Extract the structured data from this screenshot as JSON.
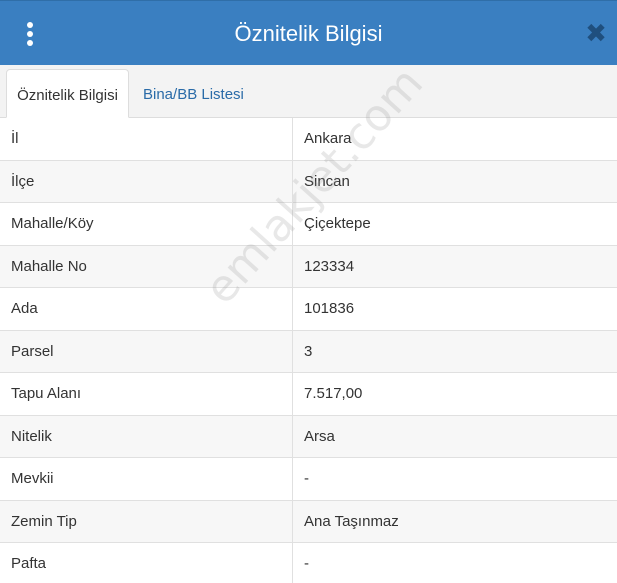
{
  "window": {
    "title": "Öznitelik Bilgisi",
    "menu_icon": "vertical-ellipsis-icon",
    "close_glyph": "✖"
  },
  "tabs": [
    {
      "label": "Öznitelik Bilgisi",
      "active": true
    },
    {
      "label": "Bina/BB Listesi",
      "active": false
    }
  ],
  "rows": [
    {
      "key": "İl",
      "value": "Ankara"
    },
    {
      "key": "İlçe",
      "value": "Sincan"
    },
    {
      "key": "Mahalle/Köy",
      "value": "Çiçektepe"
    },
    {
      "key": "Mahalle No",
      "value": "123334"
    },
    {
      "key": "Ada",
      "value": "101836"
    },
    {
      "key": "Parsel",
      "value": "3"
    },
    {
      "key": "Tapu Alanı",
      "value": "7.517,00"
    },
    {
      "key": "Nitelik",
      "value": "Arsa"
    },
    {
      "key": "Mevkii",
      "value": "-"
    },
    {
      "key": "Zemin Tip",
      "value": "Ana Taşınmaz"
    },
    {
      "key": "Pafta",
      "value": "-"
    }
  ],
  "watermark": "emlakjet.com",
  "colors": {
    "titlebar": "#3a7fc1",
    "tab_link": "#2a6ba8",
    "close_icon": "#1f4f7e"
  }
}
